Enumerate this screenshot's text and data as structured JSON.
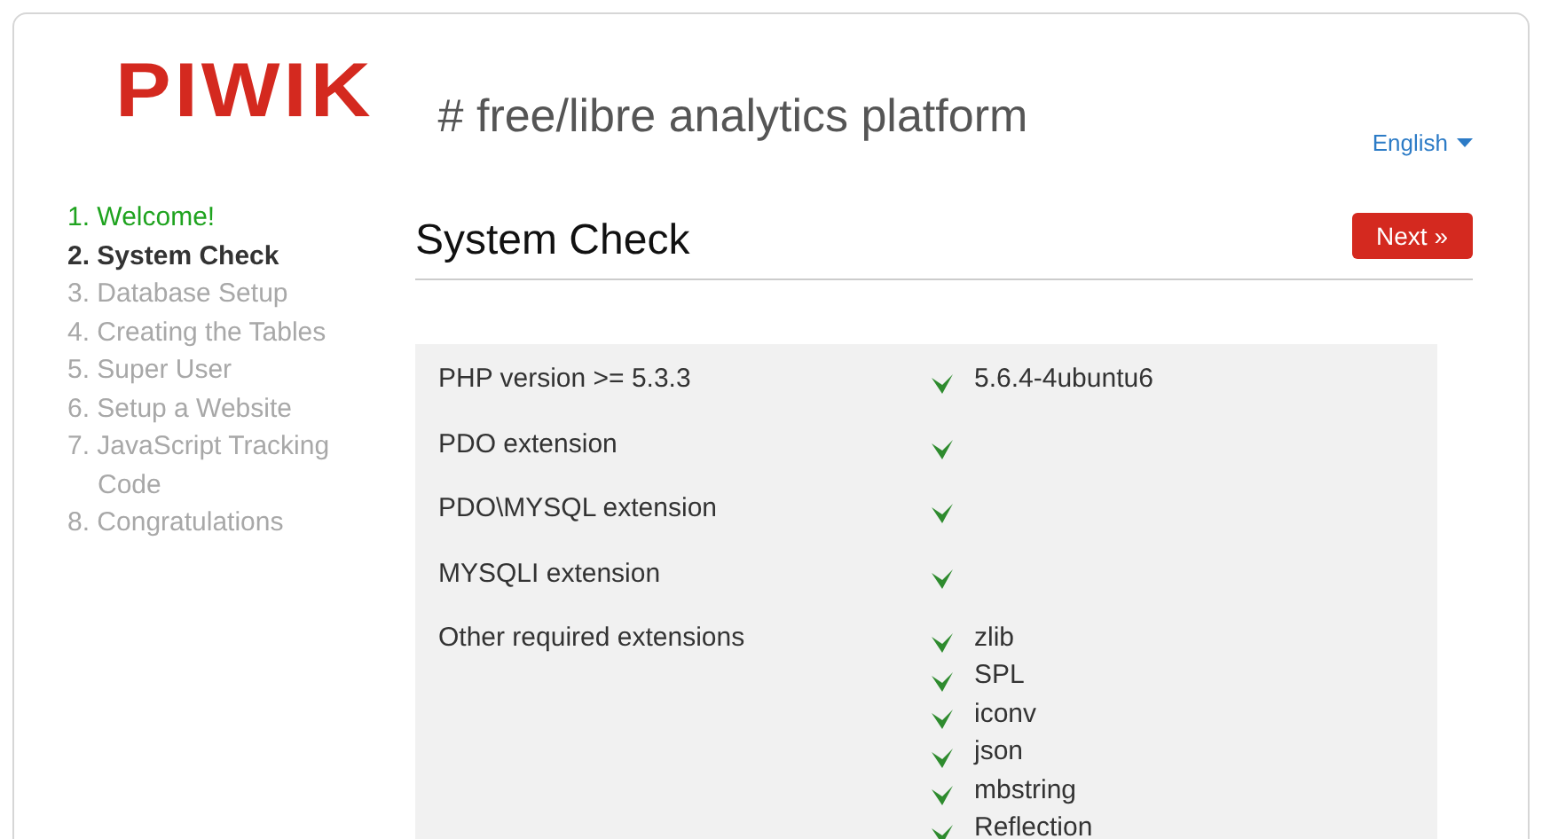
{
  "logo": "PIWIK",
  "tagline": "# free/libre analytics platform",
  "language": "English",
  "steps": [
    {
      "label": "1. Welcome!",
      "completed": true,
      "selected": false
    },
    {
      "label": "2. System Check",
      "completed": false,
      "selected": true
    },
    {
      "label": "3. Database Setup",
      "completed": false,
      "selected": false
    },
    {
      "label": "4. Creating the Tables",
      "completed": false,
      "selected": false
    },
    {
      "label": "5. Super User",
      "completed": false,
      "selected": false
    },
    {
      "label": "6. Setup a Website",
      "completed": false,
      "selected": false
    },
    {
      "label": "7. JavaScript Tracking Code",
      "completed": false,
      "selected": false
    },
    {
      "label": "8. Congratulations",
      "completed": false,
      "selected": false
    }
  ],
  "heading": "System Check",
  "next_button": "Next »",
  "checks": [
    {
      "label": "PHP version >= 5.3.3",
      "results": [
        {
          "passed": true,
          "value": "5.6.4-4ubuntu6"
        }
      ]
    },
    {
      "label": "PDO extension",
      "results": [
        {
          "passed": true
        }
      ]
    },
    {
      "label": "PDO\\MYSQL extension",
      "results": [
        {
          "passed": true
        }
      ]
    },
    {
      "label": "MYSQLI extension",
      "results": [
        {
          "passed": true
        }
      ]
    },
    {
      "label": "Other required extensions",
      "results": [
        {
          "passed": true,
          "value": "zlib"
        },
        {
          "passed": true,
          "value": "SPL"
        },
        {
          "passed": true,
          "value": "iconv"
        },
        {
          "passed": true,
          "value": "json"
        },
        {
          "passed": true,
          "value": "mbstring"
        },
        {
          "passed": true,
          "value": "Reflection"
        }
      ]
    }
  ]
}
